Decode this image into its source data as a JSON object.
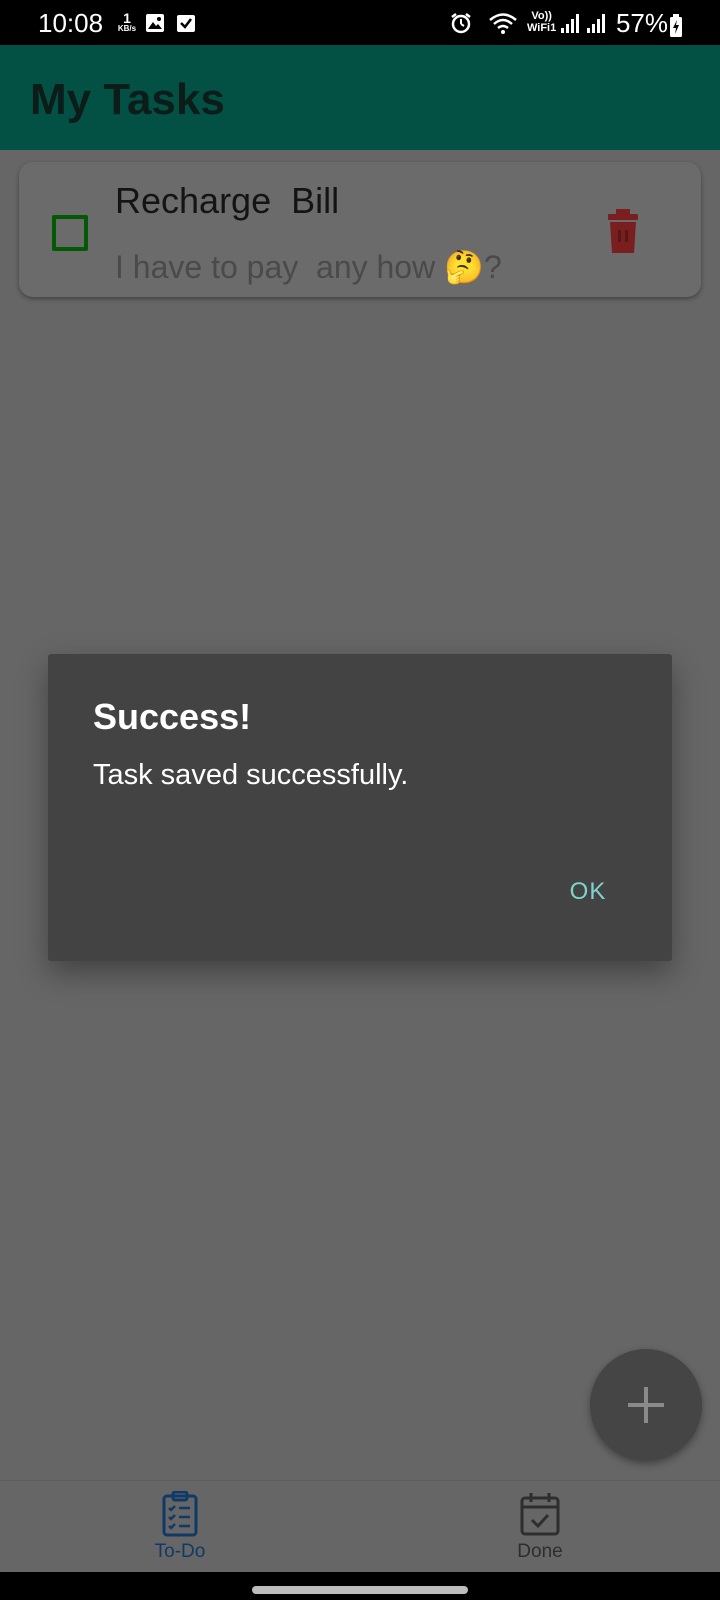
{
  "status_bar": {
    "time": "10:08",
    "net_speed_value": "1",
    "net_speed_unit": "KB/s",
    "vowifi": "Vo))",
    "vowifi_sub": "WiFi1",
    "battery": "57%"
  },
  "app_bar": {
    "title": "My Tasks"
  },
  "tasks": [
    {
      "title": "Recharge  Bill",
      "description": "I have to pay  any how 🤔?",
      "checked": false
    }
  ],
  "dialog": {
    "title": "Success!",
    "message": "Task saved successfully.",
    "ok_label": "OK"
  },
  "bottom_nav": {
    "items": [
      {
        "label": "To-Do",
        "icon": "clipboard-list-icon",
        "selected": true
      },
      {
        "label": "Done",
        "icon": "calendar-check-icon",
        "selected": false
      }
    ]
  },
  "fab": {
    "icon": "plus-icon"
  },
  "colors": {
    "app_bar": "#00796B",
    "delete": "#D32F2F",
    "checkbox": "#0A8A0A",
    "dialog_ok": "#80CBC4",
    "nav_selected": "#1E63B5"
  }
}
